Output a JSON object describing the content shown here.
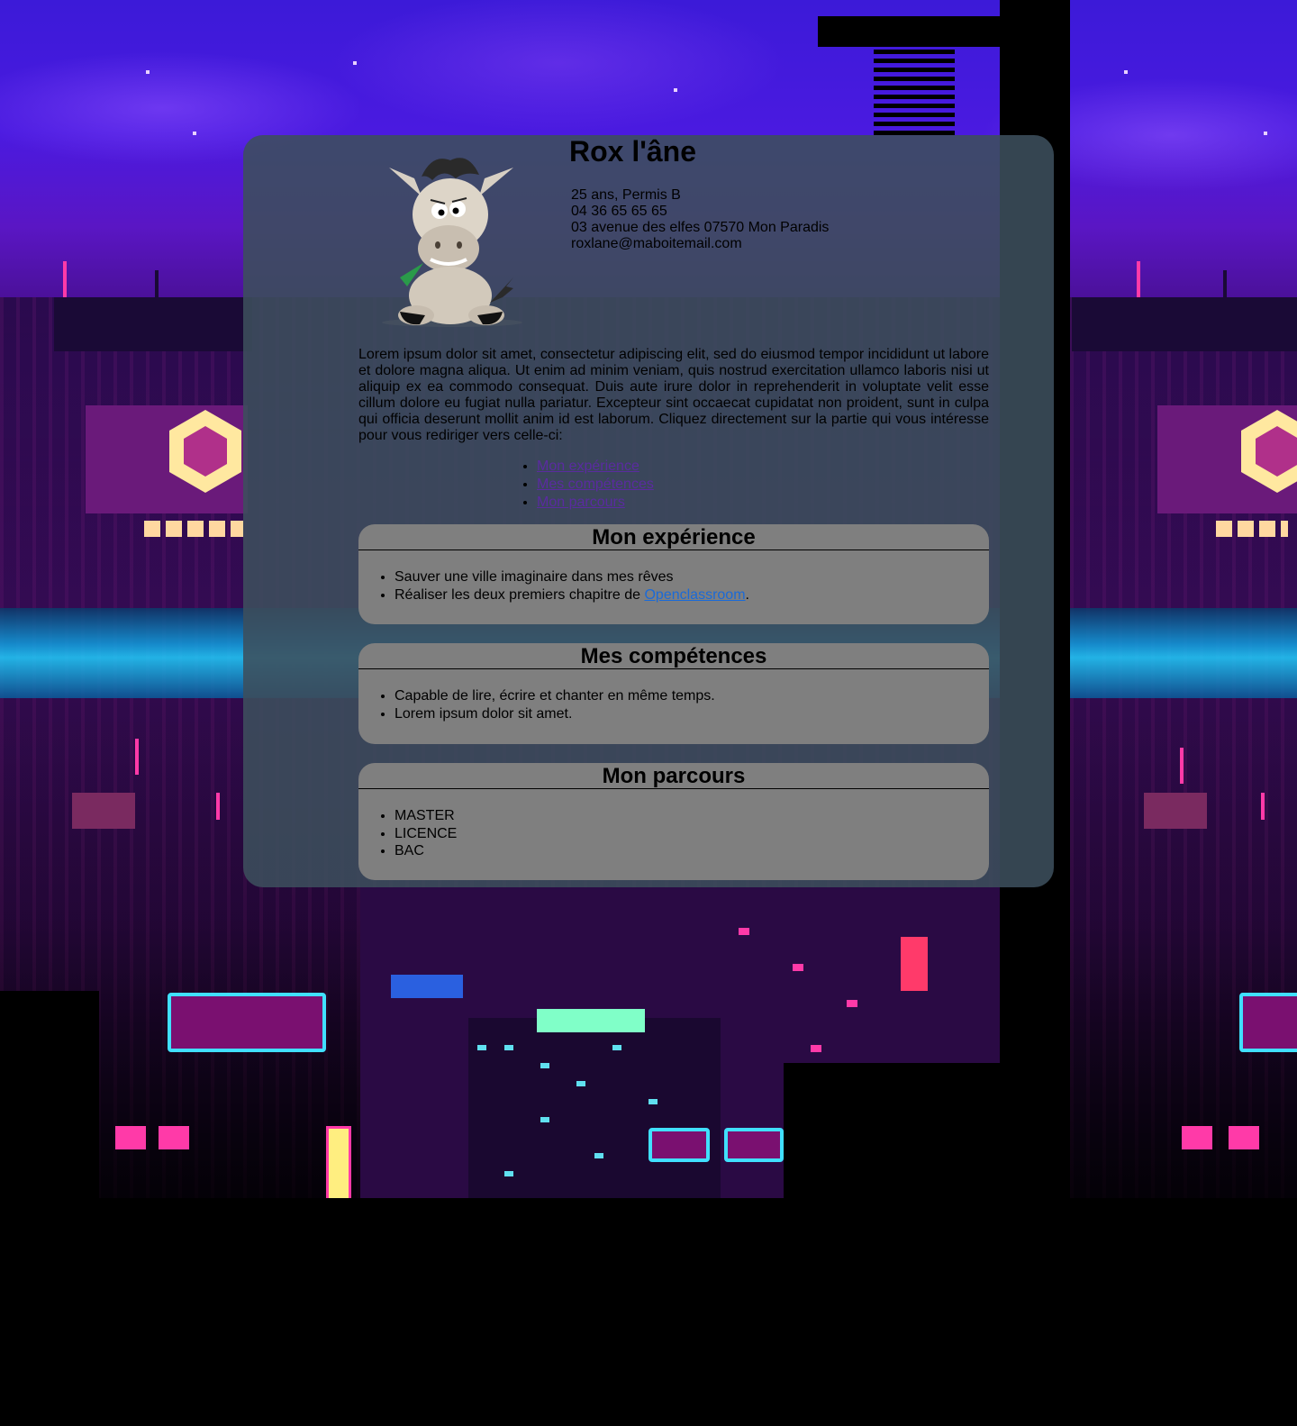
{
  "profile": {
    "name": "Rox l'âne",
    "details": [
      "25 ans, Permis B",
      "04 36 65 65 65",
      "03 avenue des elfes 07570 Mon Paradis",
      "roxlane@maboitemail.com"
    ]
  },
  "intro": "Lorem ipsum dolor sit amet, consectetur adipiscing elit, sed do eiusmod tempor incididunt ut labore et dolore magna aliqua. Ut enim ad minim veniam, quis nostrud exercitation ullamco laboris nisi ut aliquip ex ea commodo consequat. Duis aute irure dolor in reprehenderit in voluptate velit esse cillum dolore eu fugiat nulla pariatur. Excepteur sint occaecat cupidatat non proident, sunt in culpa qui officia deserunt mollit anim id est laborum. Cliquez directement sur la partie qui vous intéresse pour vous rediriger vers celle-ci:",
  "toc": [
    "Mon expérience",
    "Mes compétences",
    "Mon parcours"
  ],
  "experience": {
    "title": "Mon expérience",
    "item1": "Sauver une ville imaginaire dans mes rêves",
    "item2_prefix": "Réaliser les deux premiers chapitre de ",
    "item2_link": "Openclassroom",
    "item2_suffix": "."
  },
  "skills": {
    "title": "Mes compétences",
    "items": [
      "Capable de lire, écrire et chanter en même temps.",
      "Lorem ipsum dolor sit amet."
    ]
  },
  "path": {
    "title": "Mon parcours",
    "items": [
      "MASTER",
      "LICENCE",
      "BAC"
    ]
  },
  "colors": {
    "card": "#3c4e5c",
    "section": "#7f7f7f",
    "toc_link": "#5a2ba0",
    "text_link": "#1a6ad8"
  }
}
